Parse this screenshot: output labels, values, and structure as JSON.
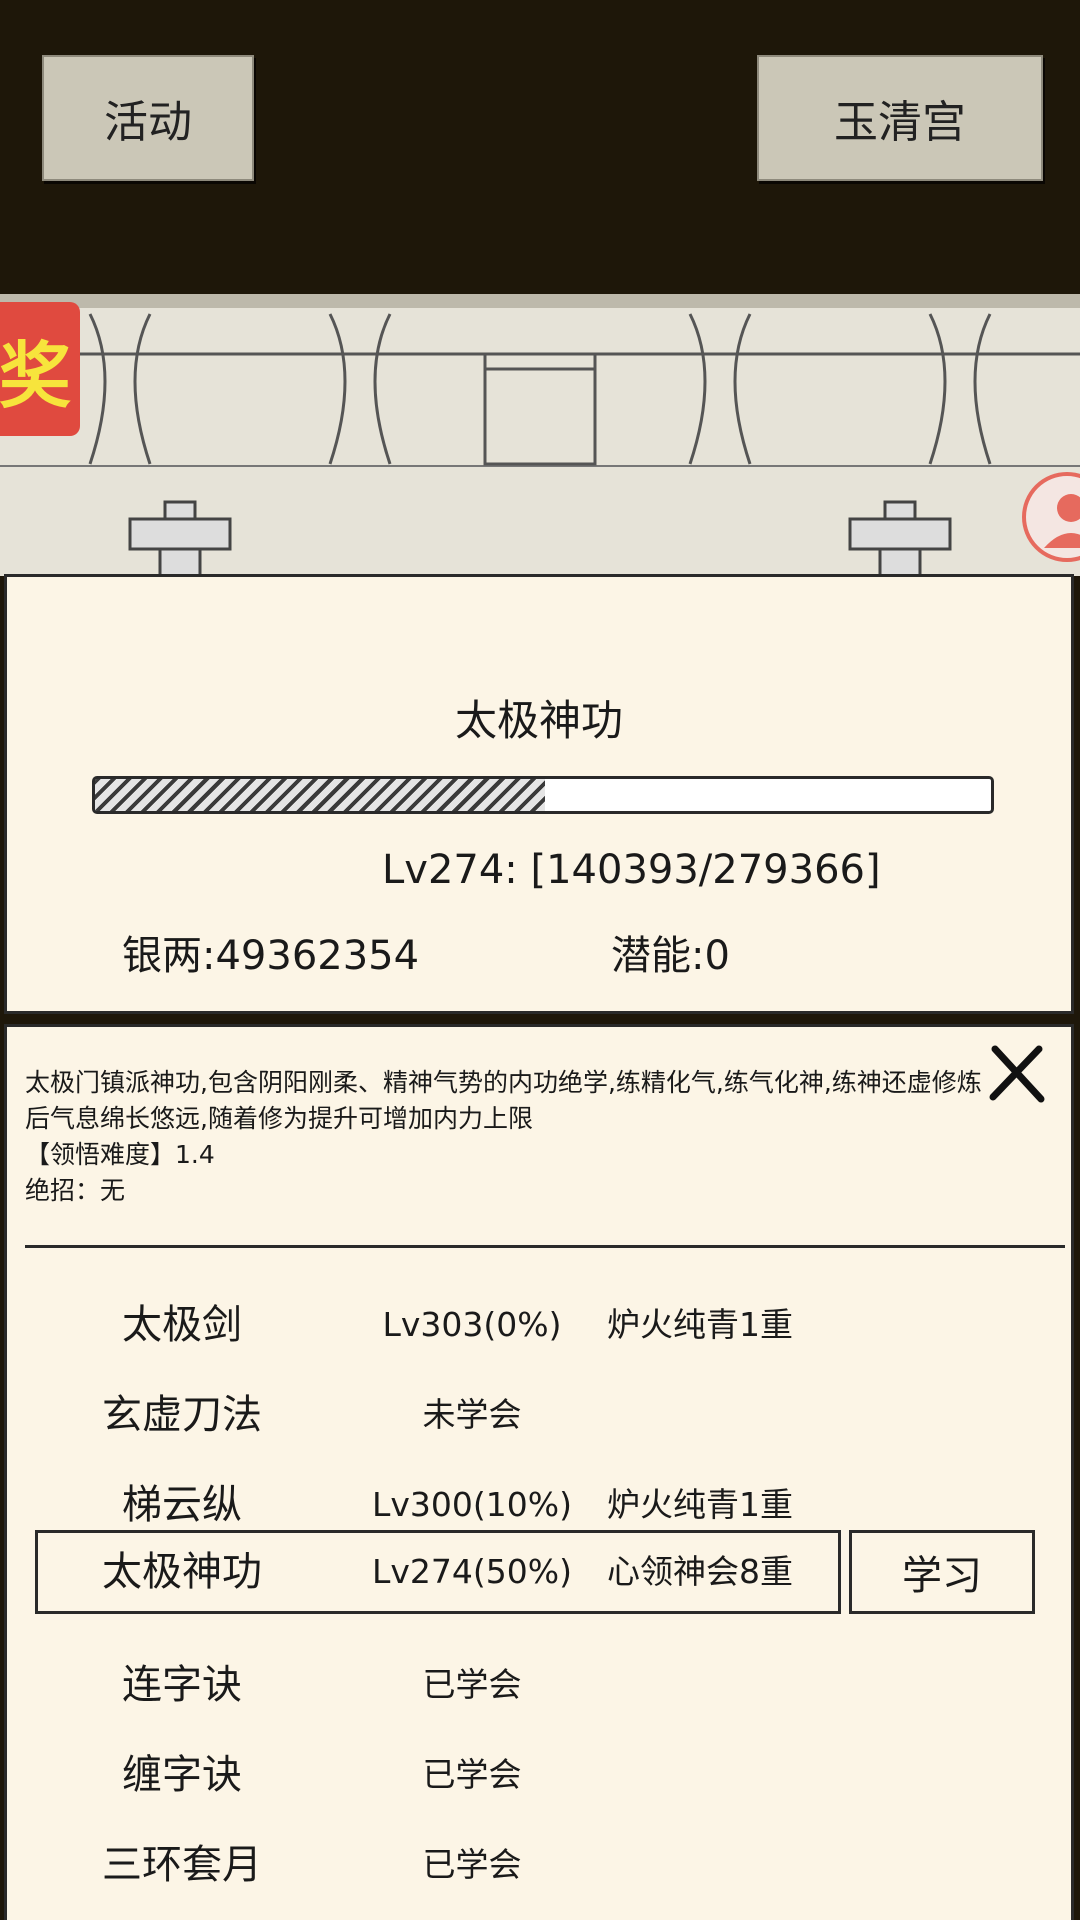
{
  "top": {
    "left_button": "活动",
    "right_button": "玉清宫"
  },
  "award_badge": "奖",
  "skill": {
    "title": "太极神功",
    "progress": 0.5025,
    "level_text": "Lv274:",
    "exp_text": "[140393/279366]",
    "silver": "银两:49362354",
    "potential": "潜能:0"
  },
  "detail": {
    "description": "太极门镇派神功,包含阴阳刚柔、精神气势的内功绝学,练精化气,练气化神,练神还虚修炼后气息绵长悠远,随着修为提升可增加内力上限",
    "difficulty": "【领悟难度】1.4",
    "ultimate": "绝招：无",
    "learn_button": "学习"
  },
  "skills_list": [
    {
      "name": "太极剑",
      "level": "Lv303(0%)",
      "realm": "炉火纯青1重"
    },
    {
      "name": "玄虚刀法",
      "level": "未学会",
      "realm": ""
    },
    {
      "name": "梯云纵",
      "level": "Lv300(10%)",
      "realm": "炉火纯青1重"
    },
    {
      "name": "太极神功",
      "level": "Lv274(50%)",
      "realm": "心领神会8重"
    },
    {
      "name": "连字诀",
      "level": "已学会",
      "realm": ""
    },
    {
      "name": "缠字诀",
      "level": "已学会",
      "realm": ""
    },
    {
      "name": "三环套月",
      "level": "已学会",
      "realm": ""
    }
  ],
  "colors": {
    "panel": "#fcf5e6",
    "top_bg": "#1e1709",
    "button": "#cbc7b7",
    "badge": "#e04a3f"
  }
}
